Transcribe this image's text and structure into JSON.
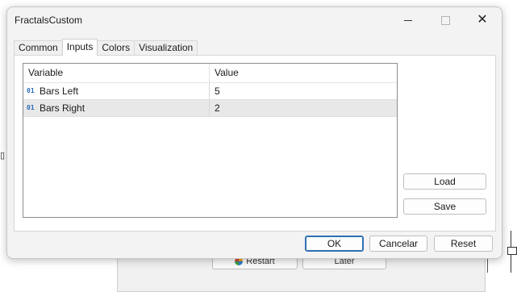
{
  "background": {
    "restart_label": "Restart",
    "later_label": "Later"
  },
  "dialog": {
    "title": "FractalsCustom",
    "controls": {
      "minimize_icon": "minimize-icon",
      "maximize_icon": "maximize-icon",
      "close_icon": "close-icon"
    }
  },
  "tabs": [
    {
      "label": "Common",
      "active": false
    },
    {
      "label": "Inputs",
      "active": true
    },
    {
      "label": "Colors",
      "active": false
    },
    {
      "label": "Visualization",
      "active": false
    }
  ],
  "table": {
    "columns": [
      "Variable",
      "Value"
    ],
    "rows": [
      {
        "type_icon": "01",
        "variable": "Bars Left",
        "value": "5"
      },
      {
        "type_icon": "01",
        "variable": "Bars Right",
        "value": "2"
      }
    ]
  },
  "side_buttons": {
    "load_label": "Load",
    "save_label": "Save"
  },
  "buttons": {
    "ok_label": "OK",
    "cancel_label": "Cancelar",
    "reset_label": "Reset"
  },
  "colors": {
    "accent": "#2f6fb5",
    "type_icon": "#2a6db8",
    "selected_row": "#e8e8e8"
  }
}
